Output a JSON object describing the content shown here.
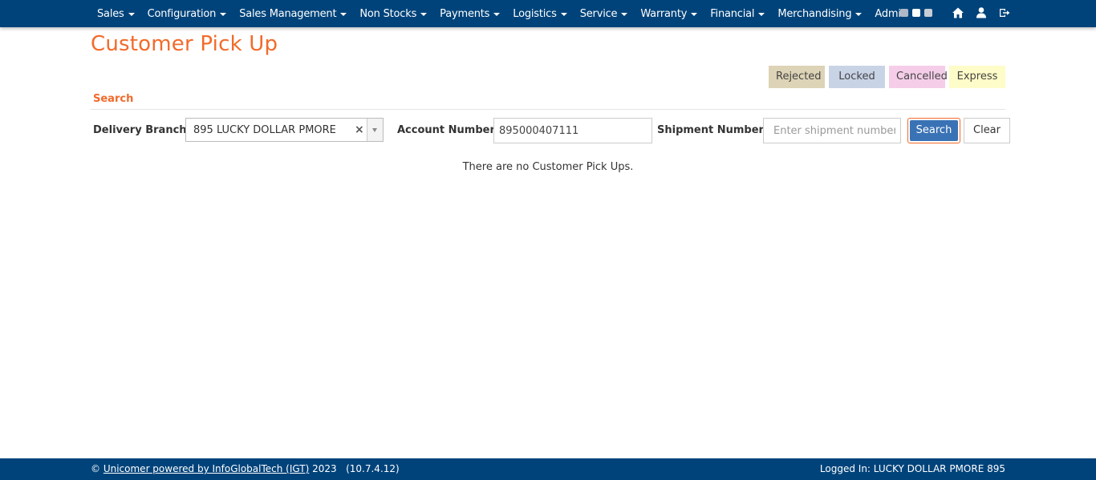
{
  "nav": {
    "items": [
      {
        "label": "Sales"
      },
      {
        "label": "Configuration"
      },
      {
        "label": "Sales Management"
      },
      {
        "label": "Non Stocks"
      },
      {
        "label": "Payments"
      },
      {
        "label": "Logistics"
      },
      {
        "label": "Service"
      },
      {
        "label": "Warranty"
      },
      {
        "label": "Financial"
      },
      {
        "label": "Merchandising"
      },
      {
        "label": "Administr"
      }
    ],
    "icons": [
      "home-icon",
      "user-icon",
      "logout-icon"
    ]
  },
  "page": {
    "title": "Customer Pick Up"
  },
  "legend": {
    "rejected": "Rejected",
    "locked": "Locked",
    "cancelled": "Cancelled",
    "express": "Express",
    "colors": {
      "rejected": "#ddd3b6",
      "locked": "#c9d3e6",
      "cancelled": "#f5cde8",
      "express": "#fefcc8"
    }
  },
  "search": {
    "section_title": "Search",
    "delivery_branch_label": "Delivery Branch:",
    "delivery_branch_value": "895 LUCKY DOLLAR PMORE",
    "clear_glyph": "×",
    "account_number_label": "Account Number:",
    "account_number_value": "895000407111",
    "shipment_number_label": "Shipment Number:",
    "shipment_number_placeholder": "Enter shipment number",
    "search_button": "Search",
    "clear_button": "Clear"
  },
  "results": {
    "empty_message": "There are no Customer Pick Ups."
  },
  "footer": {
    "copyright": "©",
    "company_link": "Unicomer powered by InfoGlobalTech (IGT)",
    "year_version": "2023   (10.7.4.12)",
    "logged_in": "Logged In: LUCKY DOLLAR PMORE 895"
  },
  "colors": {
    "navbar": "#00437a",
    "accent": "#f26a2a",
    "primary_button": "#3a73b5"
  }
}
